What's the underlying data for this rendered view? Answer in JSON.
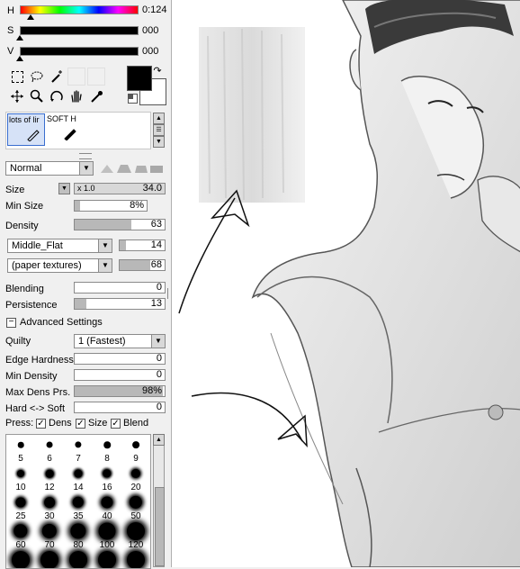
{
  "color": {
    "h_label": "H",
    "h_value": "0:124",
    "s_label": "S",
    "s_value": "000",
    "v_label": "V",
    "v_value": "000",
    "primary": "#000000",
    "secondary": "#ffffff"
  },
  "brush_presets": [
    {
      "label": "lots of lir",
      "icon": "brush-pen-icon"
    },
    {
      "label": "SOFT H",
      "icon": "brush-pen-icon"
    }
  ],
  "blend_mode": "Normal",
  "params": {
    "size_label": "Size",
    "size_mult": "x 1.0",
    "size_value": "34.0",
    "minsize_label": "Min Size",
    "minsize_value": "8%",
    "minsize_fraction": 0.08,
    "density_label": "Density",
    "density_value": "63",
    "density_fraction": 0.63,
    "shape_dd": "Middle_Flat",
    "shape_value": "14",
    "shape_fraction": 0.14,
    "texture_dd": "(paper textures)",
    "texture_value": "68",
    "texture_fraction": 0.68,
    "blending_label": "Blending",
    "blending_value": "0",
    "persistence_label": "Persistence",
    "persistence_value": "13",
    "persistence_fraction": 0.13,
    "advanced_label": "Advanced Settings",
    "quality_label": "Quilty",
    "quality_dd": "1 (Fastest)",
    "edge_label": "Edge Hardness",
    "edge_value": "0",
    "mindens_label": "Min Density",
    "mindens_value": "0",
    "maxdens_label": "Max Dens Prs.",
    "maxdens_value": "98%",
    "maxdens_fraction": 0.98,
    "hardsoft_label": "Hard <-> Soft",
    "hardsoft_value": "0",
    "press_label": "Press:",
    "press_dens": "Dens",
    "press_size": "Size",
    "press_blend": "Blend"
  },
  "brush_sizes": [
    "5",
    "6",
    "7",
    "8",
    "9",
    "10",
    "12",
    "14",
    "16",
    "20",
    "25",
    "30",
    "35",
    "40",
    "50",
    "60",
    "70",
    "80",
    "100",
    "120",
    "",
    "",
    "",
    "",
    ""
  ]
}
